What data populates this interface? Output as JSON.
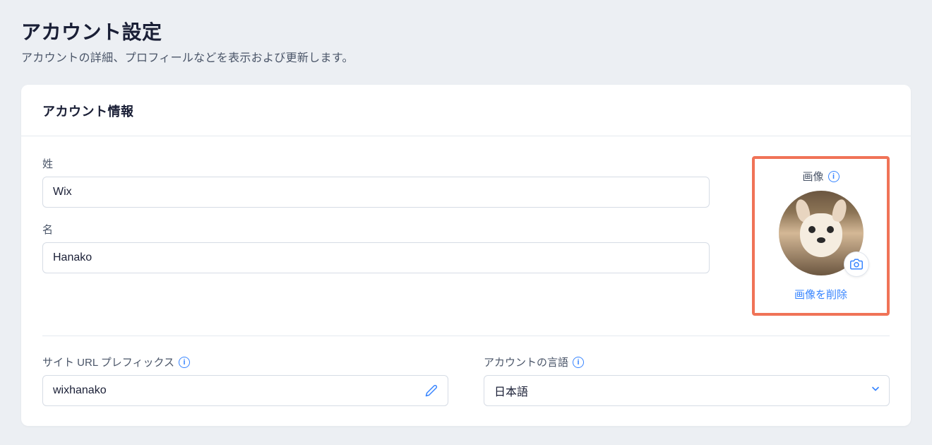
{
  "page": {
    "title": "アカウント設定",
    "subtitle": "アカウントの詳細、プロフィールなどを表示および更新します。"
  },
  "account_info": {
    "section_title": "アカウント情報",
    "last_name": {
      "label": "姓",
      "value": "Wix"
    },
    "first_name": {
      "label": "名",
      "value": "Hanako"
    },
    "image": {
      "label": "画像",
      "delete_label": "画像を削除"
    },
    "site_url_prefix": {
      "label": "サイト URL プレフィックス",
      "value": "wixhanako"
    },
    "account_language": {
      "label": "アカウントの言語",
      "value": "日本語"
    }
  },
  "colors": {
    "highlight_border": "#f07357",
    "link": "#3885ff"
  }
}
